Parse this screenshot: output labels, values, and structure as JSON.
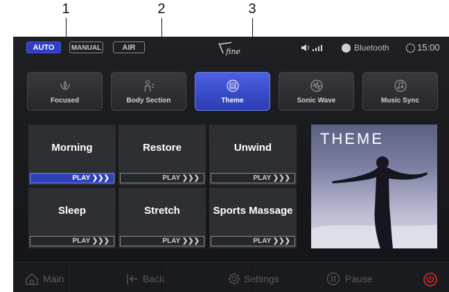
{
  "callouts": [
    "1",
    "2",
    "3"
  ],
  "status_bar": {
    "modes": [
      {
        "label": "AUTO",
        "active": true
      },
      {
        "label": "MANUAL",
        "active": false
      },
      {
        "label": "AIR",
        "active": false
      }
    ],
    "logo_text": "Vfine",
    "bluetooth_label": "Bluetooth",
    "clock": "15:00"
  },
  "tabs": [
    {
      "label": "Focused",
      "icon": "focused-icon",
      "active": false
    },
    {
      "label": "Body Section",
      "icon": "body-section-icon",
      "active": false
    },
    {
      "label": "Theme",
      "icon": "theme-icon",
      "active": true
    },
    {
      "label": "Sonic Wave",
      "icon": "sonic-wave-icon",
      "active": false
    },
    {
      "label": "Music Sync",
      "icon": "music-sync-icon",
      "active": false
    }
  ],
  "programs": [
    {
      "title": "Morning",
      "play": "PLAY ❯❯❯",
      "active": true
    },
    {
      "title": "Restore",
      "play": "PLAY ❯❯❯",
      "active": false
    },
    {
      "title": "Unwind",
      "play": "PLAY ❯❯❯",
      "active": false
    },
    {
      "title": "Sleep",
      "play": "PLAY ❯❯❯",
      "active": false
    },
    {
      "title": "Stretch",
      "play": "PLAY ❯❯❯",
      "active": false
    },
    {
      "title": "Sports Massage",
      "play": "PLAY ❯❯❯",
      "active": false
    }
  ],
  "theme_image_label": "THEME",
  "bottom_bar": {
    "main": "Main",
    "back": "Back",
    "settings": "Settings",
    "pause": "Pause"
  },
  "colors": {
    "accent": "#3346c9",
    "power": "#e52a2a",
    "background": "#1b1c1f"
  }
}
